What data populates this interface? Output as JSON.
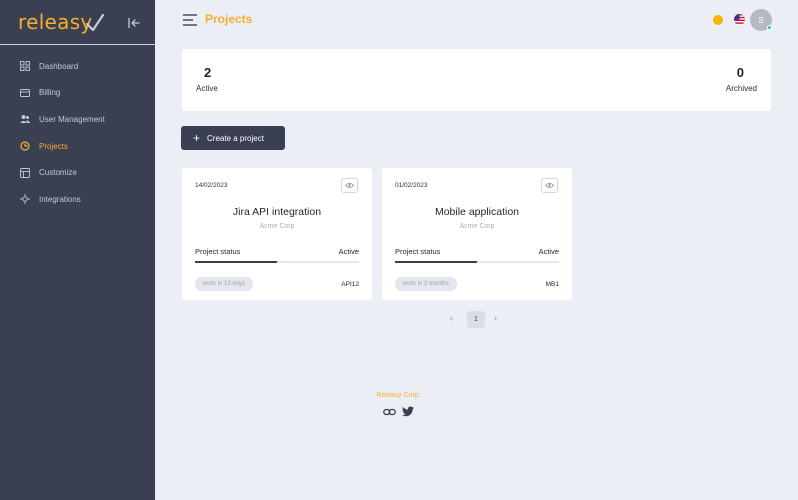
{
  "brand": {
    "logo_text": "releasy",
    "accent": "#f6ae2d"
  },
  "sidebar": {
    "items": [
      {
        "label": "Dashboard",
        "icon": "dashboard-icon",
        "active": false
      },
      {
        "label": "Billing",
        "icon": "billing-icon",
        "active": false
      },
      {
        "label": "User Management",
        "icon": "users-icon",
        "active": false
      },
      {
        "label": "Projects",
        "icon": "projects-icon",
        "active": true
      },
      {
        "label": "Customize",
        "icon": "customize-icon",
        "active": false
      },
      {
        "label": "Integrations",
        "icon": "integrations-icon",
        "active": false
      }
    ]
  },
  "header": {
    "title": "Projects",
    "avatar_initial": "S"
  },
  "stats": {
    "active": {
      "value": "2",
      "label": "Active"
    },
    "archived": {
      "value": "0",
      "label": "Archived"
    }
  },
  "actions": {
    "create_label": "Create a project"
  },
  "projects": [
    {
      "date": "14/02/2023",
      "name": "Jira API integration",
      "company": "Acme Corp",
      "status_label": "Project status",
      "status": "Active",
      "progress": 0.5,
      "due": "ends in 13 days",
      "code": "API12"
    },
    {
      "date": "01/02/2023",
      "name": "Mobile application",
      "company": "Acme Corp",
      "status_label": "Project status",
      "status": "Active",
      "progress": 0.5,
      "due": "ends in 2 months",
      "code": "MB1"
    }
  ],
  "pagination": {
    "prev": "‹",
    "current": "1",
    "next": "›"
  },
  "footer": {
    "company": "Releasy Corp."
  }
}
